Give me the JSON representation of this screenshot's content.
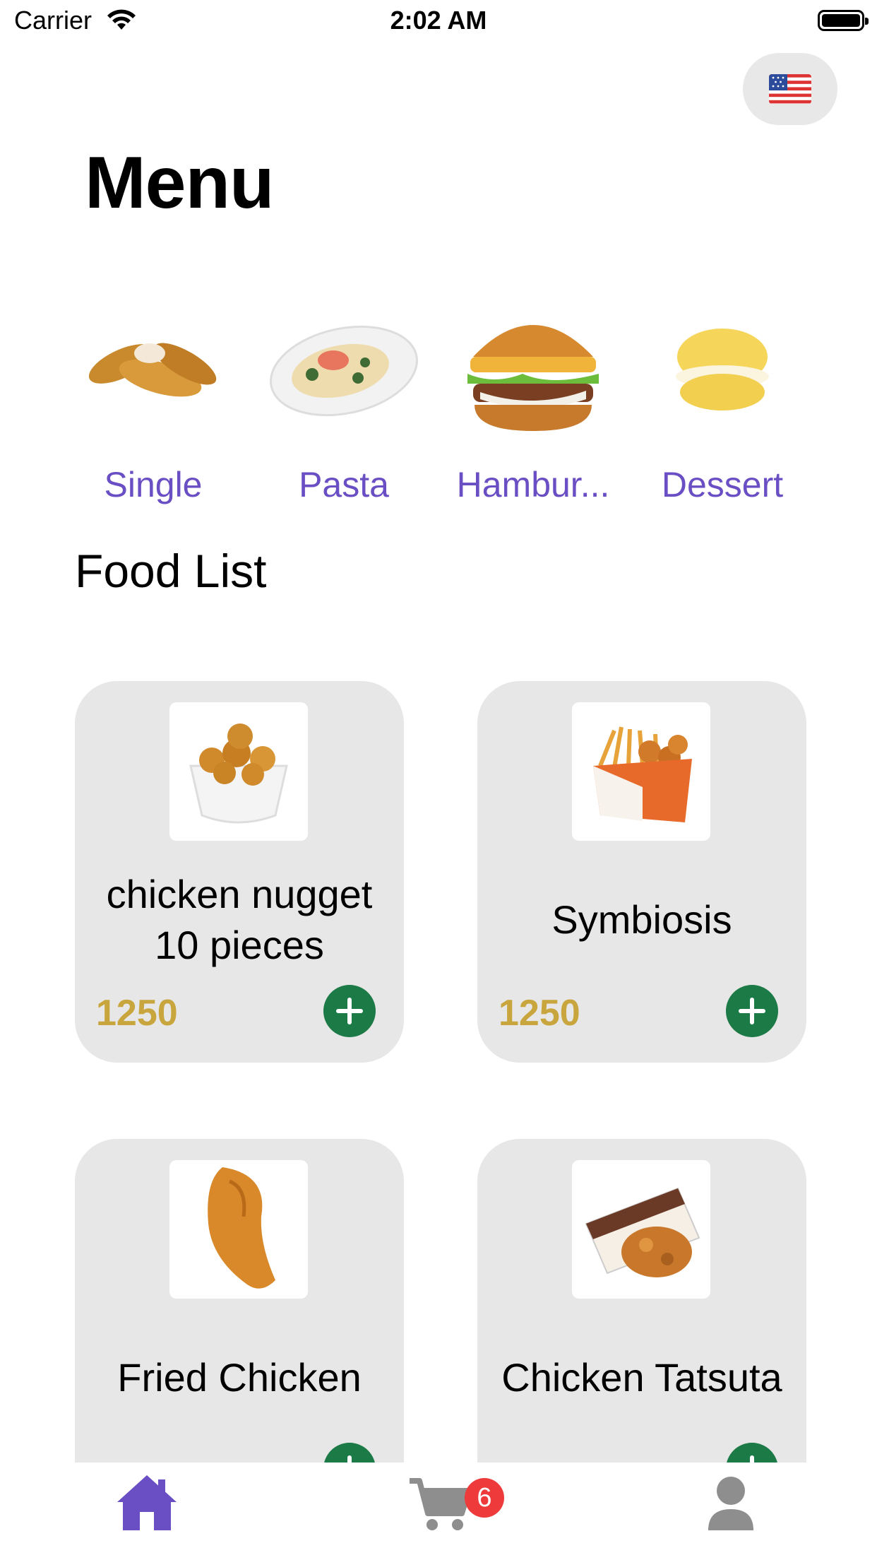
{
  "status_bar": {
    "carrier": "Carrier",
    "time": "2:02 AM"
  },
  "header": {
    "language_flag": "us-flag-icon",
    "title": "Menu"
  },
  "categories": [
    {
      "label": "Single",
      "icon": "chicken-tenders-image"
    },
    {
      "label": "Pasta",
      "icon": "pasta-plate-image"
    },
    {
      "label": "Hambur...",
      "icon": "hamburger-image"
    },
    {
      "label": "Dessert",
      "icon": "cream-puff-image"
    }
  ],
  "food_list": {
    "title": "Food List",
    "items": [
      {
        "name": "chicken nugget 10 pieces",
        "price": "1250",
        "icon": "chicken-nugget-bowl-image"
      },
      {
        "name": "Symbiosis",
        "price": "1250",
        "icon": "fries-box-image"
      },
      {
        "name": "Fried Chicken",
        "price": "",
        "icon": "fried-chicken-image"
      },
      {
        "name": "Chicken Tatsuta",
        "price": "",
        "icon": "chicken-tatsuta-bag-image"
      }
    ]
  },
  "tab_bar": {
    "items": [
      {
        "name": "home",
        "icon": "home-icon"
      },
      {
        "name": "cart",
        "icon": "cart-icon"
      },
      {
        "name": "profile",
        "icon": "person-icon"
      }
    ],
    "cart_badge": "6"
  },
  "colors": {
    "accent": "#6a4ec4",
    "price": "#c8a63d",
    "add_button": "#1b7a45",
    "card": "#e7e7e7",
    "badge": "#ee3a3a"
  }
}
